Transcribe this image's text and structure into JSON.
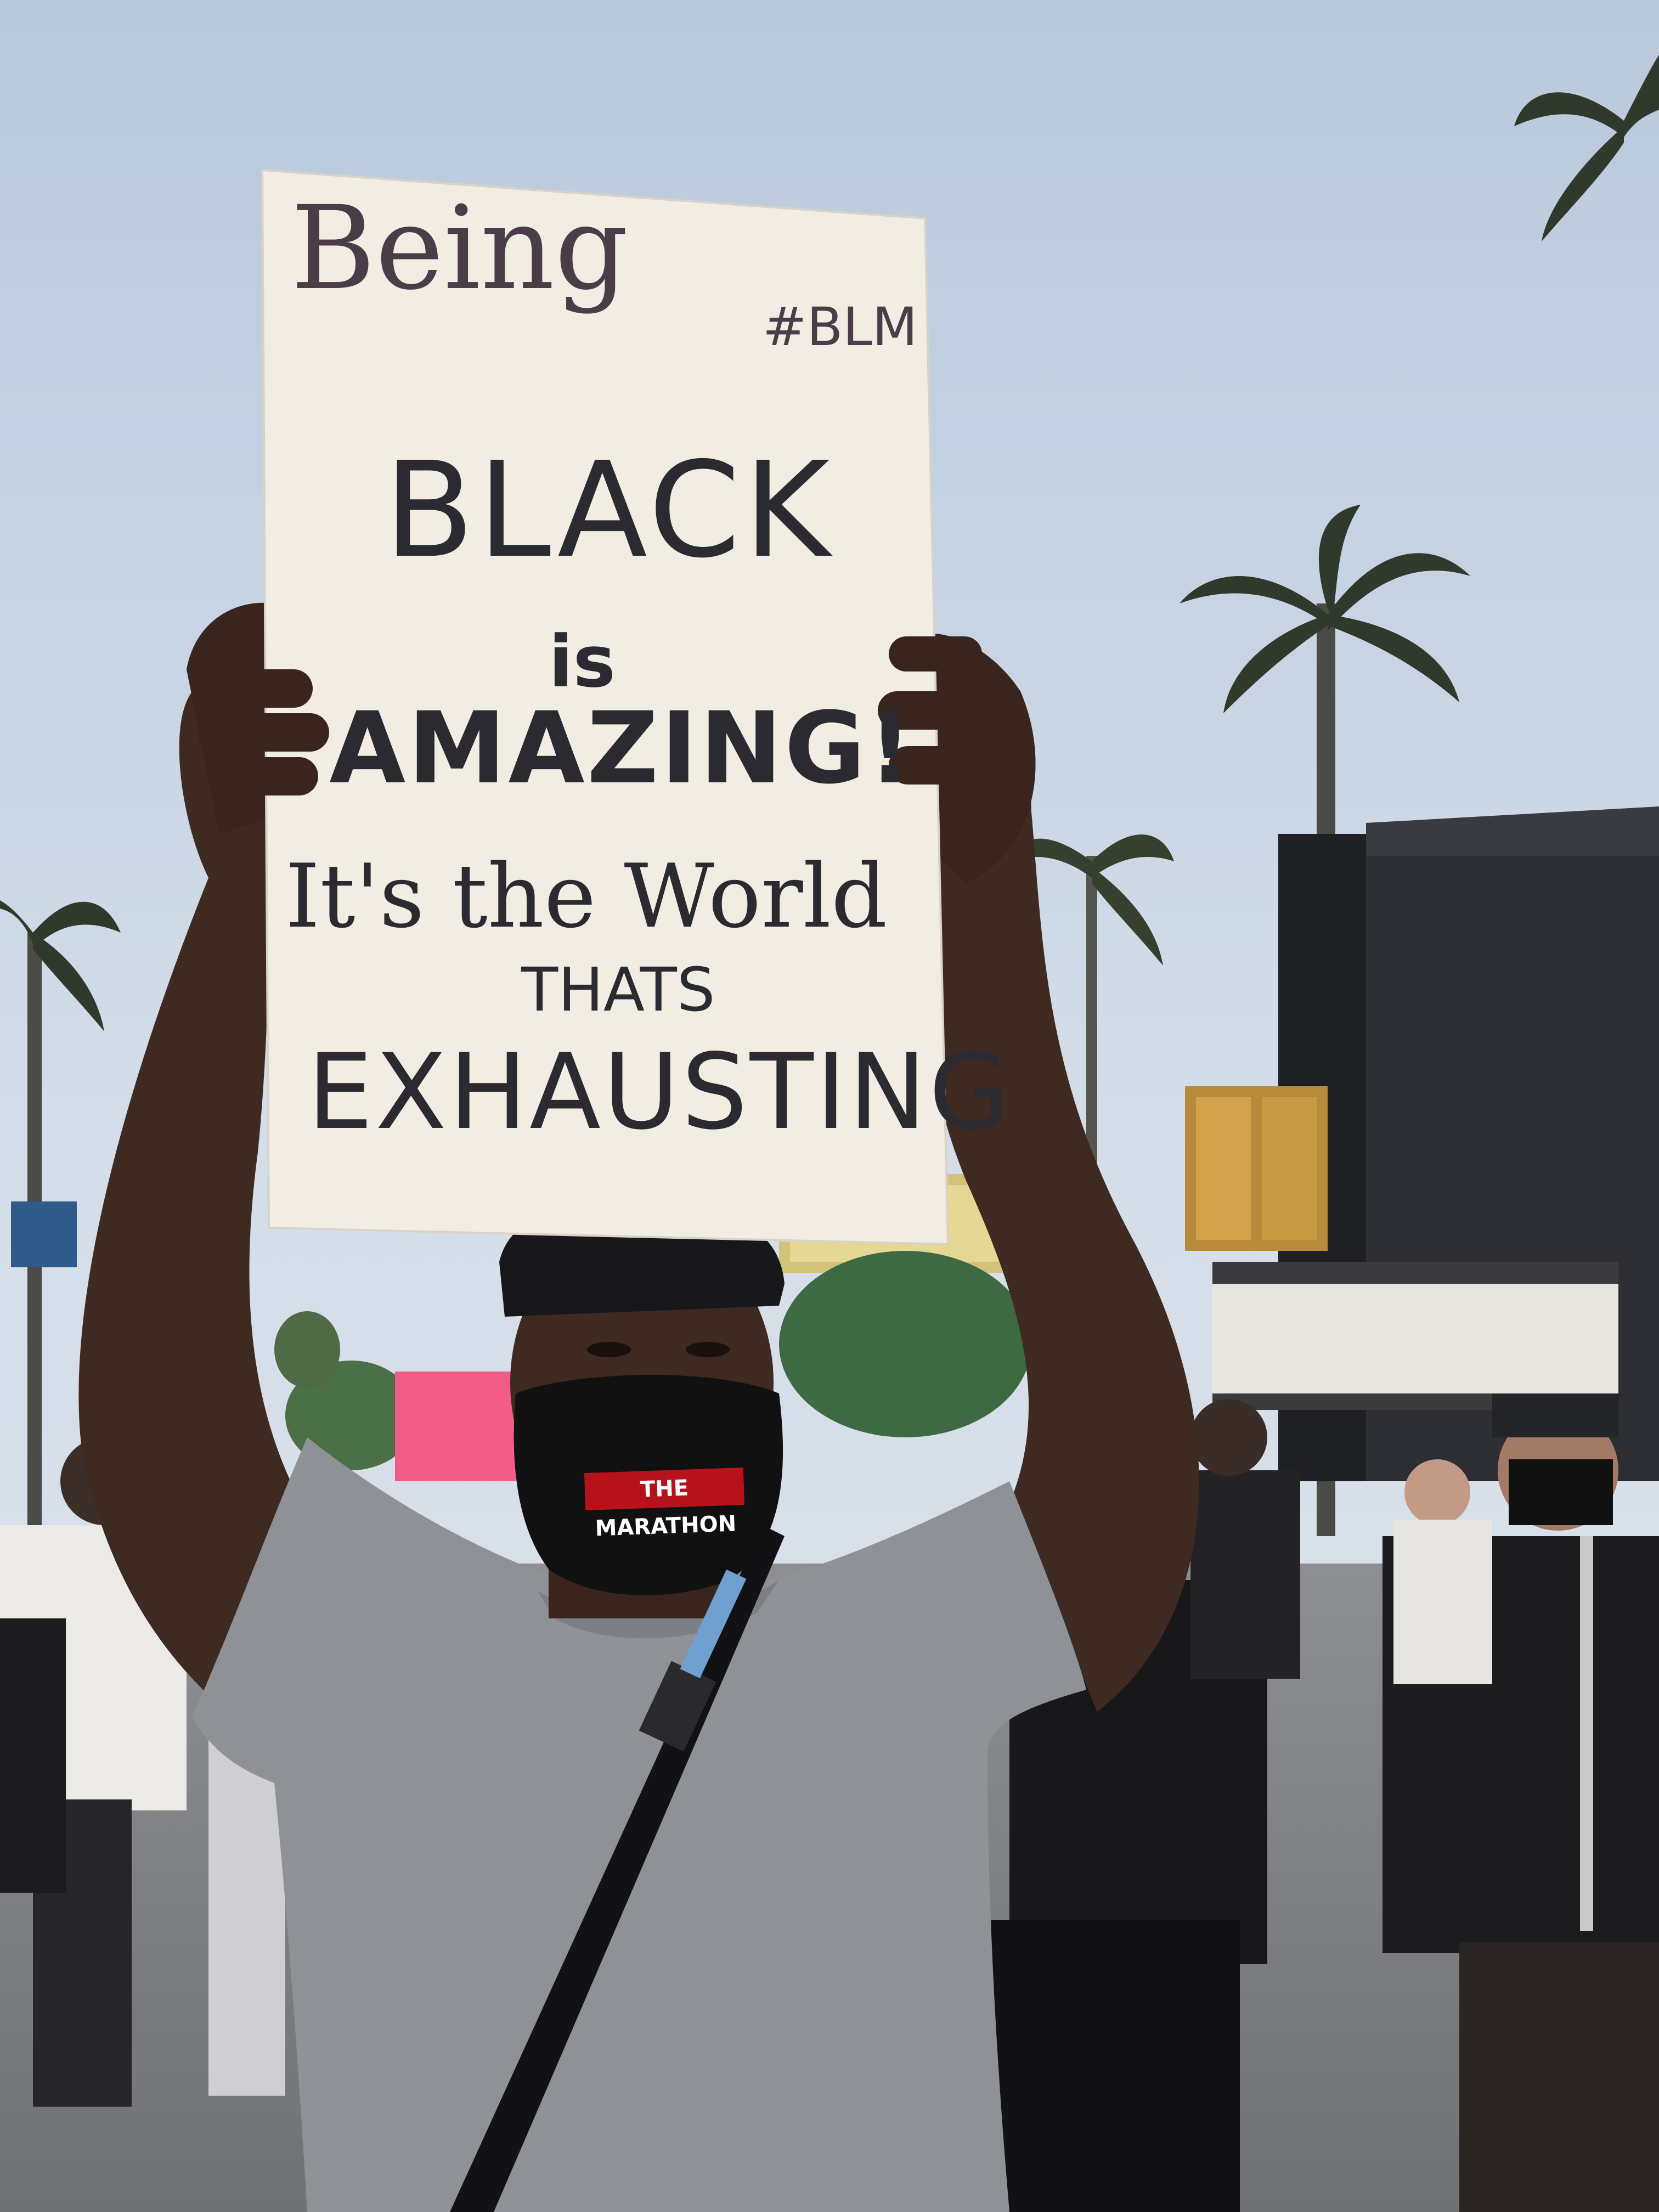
{
  "sign": {
    "line1": "Being",
    "hashtag": "#BLM",
    "line2": "BLACK",
    "line3": "is",
    "line4": "AMAZING!",
    "line5": "It's the World",
    "line6": "THATS",
    "line7": "EXHAUSTING"
  },
  "mask": {
    "label": "THE MARATHON"
  },
  "colors": {
    "sky": "#c9d6e6",
    "sign_paper": "#f1ede2",
    "ink": "#2b2a30",
    "shirt": "#8e9196",
    "skin": "#3f2a22",
    "mask": "#111111",
    "mask_label": "#b5121b",
    "pink_sign": "#f25c86",
    "building": "#2d2e33"
  }
}
